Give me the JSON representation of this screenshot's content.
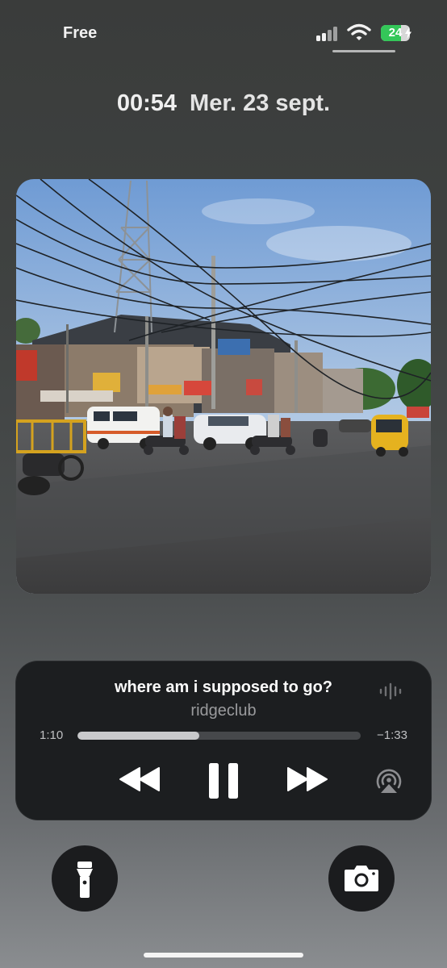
{
  "status_bar": {
    "carrier": "Free",
    "battery": "24",
    "battery_color": "#34c759",
    "icons": [
      "signal-icon",
      "wifi-icon",
      "battery-icon",
      "charging-bolt-icon"
    ]
  },
  "lock_screen": {
    "time": "00:54",
    "date": "Mer. 23 sept."
  },
  "now_playing": {
    "artwork_description_icon": "album-artwork",
    "title": "where am i supposed to go?",
    "artist": "ridgeclub",
    "elapsed": "1:10",
    "remaining": "−1:33",
    "progress": 0.43,
    "controls": [
      "rewind-icon",
      "pause-icon",
      "fast-forward-icon",
      "airplay-icon",
      "waveform-icon"
    ]
  },
  "quick_actions": {
    "left": "flashlight-icon",
    "right": "camera-icon"
  }
}
